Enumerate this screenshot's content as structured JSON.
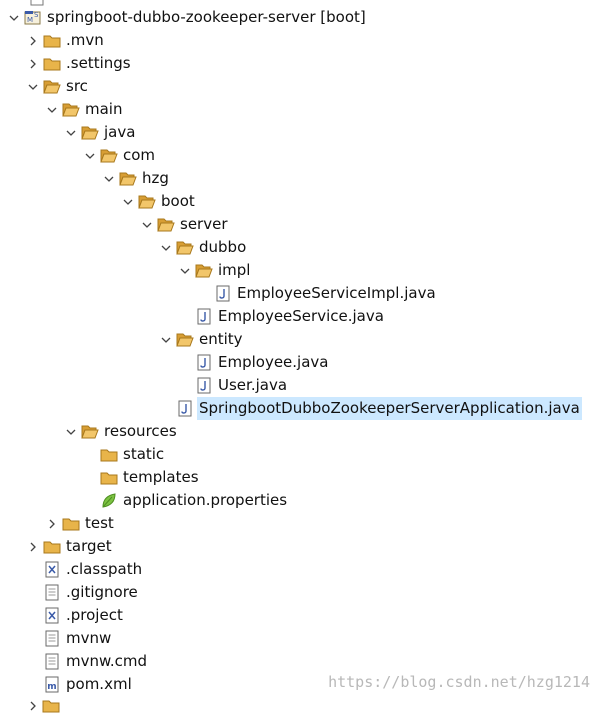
{
  "project_explorer": {
    "project": {
      "name": "springboot-dubbo-zookeeper-server",
      "tag": "[boot]"
    },
    "items": [
      {
        "label": ".mvn",
        "icon": "folder-icon"
      },
      {
        "label": ".settings",
        "icon": "folder-icon"
      },
      {
        "label": "src",
        "icon": "folder-open-icon"
      },
      {
        "label": "main",
        "icon": "folder-open-icon"
      },
      {
        "label": "java",
        "icon": "folder-open-icon"
      },
      {
        "label": "com",
        "icon": "folder-open-icon"
      },
      {
        "label": "hzg",
        "icon": "folder-open-icon"
      },
      {
        "label": "boot",
        "icon": "folder-open-icon"
      },
      {
        "label": "server",
        "icon": "folder-open-icon"
      },
      {
        "label": "dubbo",
        "icon": "folder-open-icon"
      },
      {
        "label": "impl",
        "icon": "folder-open-icon"
      },
      {
        "label": "EmployeeServiceImpl.java",
        "icon": "java-file-icon"
      },
      {
        "label": "EmployeeService.java",
        "icon": "java-file-icon"
      },
      {
        "label": "entity",
        "icon": "folder-open-icon"
      },
      {
        "label": "Employee.java",
        "icon": "java-file-icon"
      },
      {
        "label": "User.java",
        "icon": "java-file-icon"
      },
      {
        "label": "SpringbootDubboZookeeperServerApplication.java",
        "icon": "java-file-icon",
        "selected": true
      },
      {
        "label": "resources",
        "icon": "folder-open-icon"
      },
      {
        "label": "static",
        "icon": "folder-icon"
      },
      {
        "label": "templates",
        "icon": "folder-icon"
      },
      {
        "label": "application.properties",
        "icon": "properties-file-icon"
      },
      {
        "label": "test",
        "icon": "folder-icon"
      },
      {
        "label": "target",
        "icon": "folder-icon"
      },
      {
        "label": ".classpath",
        "icon": "xml-file-icon"
      },
      {
        "label": ".gitignore",
        "icon": "text-file-icon"
      },
      {
        "label": ".project",
        "icon": "xml-file-icon"
      },
      {
        "label": "mvnw",
        "icon": "text-file-icon"
      },
      {
        "label": "mvnw.cmd",
        "icon": "text-file-icon"
      },
      {
        "label": "pom.xml",
        "icon": "maven-file-icon"
      }
    ]
  },
  "watermark": "https://blog.csdn.net/hzg1214",
  "colors": {
    "folder": "#e8b44a",
    "folder_edge": "#a8781c",
    "selection": "#cce8ff",
    "java_blue": "#3a5aa8",
    "leaf_green": "#7cc242"
  }
}
